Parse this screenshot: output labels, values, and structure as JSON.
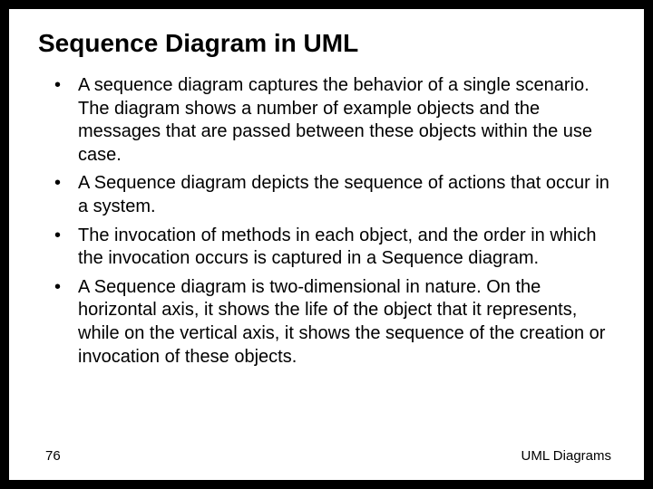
{
  "title": "Sequence Diagram in UML",
  "bullets": [
    "A sequence diagram captures the behavior of a single scenario. The diagram shows a number of example objects and the messages that are passed between these objects within the use case.",
    "A Sequence diagram depicts the sequence of actions that occur in a system.",
    "The invocation of methods in each object, and the order in which the invocation occurs is captured in a Sequence diagram.",
    "A Sequence diagram is two-dimensional in nature. On the horizontal axis, it shows the life of the object that it represents, while on the vertical axis, it shows the sequence of the creation or invocation of these objects."
  ],
  "footer": {
    "page": "76",
    "label": "UML Diagrams"
  }
}
